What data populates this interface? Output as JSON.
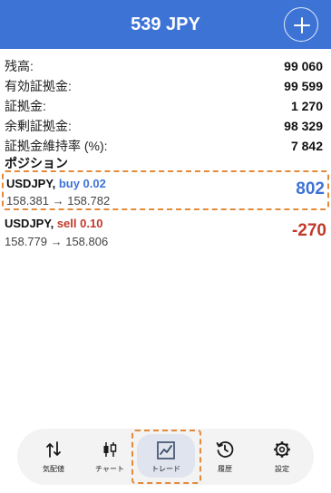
{
  "header": {
    "title": "539 JPY",
    "add_icon": "plus-icon"
  },
  "summary": {
    "rows": [
      {
        "label": "残高:",
        "value": "99 060"
      },
      {
        "label": "有効証拠金:",
        "value": "99 599"
      },
      {
        "label": "証拠金:",
        "value": "1 270"
      },
      {
        "label": "余剰証拠金:",
        "value": "98 329"
      },
      {
        "label": "証拠金維持率 (%):",
        "value": "7 842"
      }
    ]
  },
  "positions": {
    "title": "ポジション",
    "items": [
      {
        "symbol": "USDJPY,",
        "side": "buy 0.02",
        "prices": "158.381 → 158.782",
        "pl": "802"
      },
      {
        "symbol": "USDJPY,",
        "side": "sell 0.10",
        "prices": "158.779 → 158.806",
        "pl": "-270"
      }
    ]
  },
  "nav": {
    "items": [
      {
        "label": "気配値",
        "icon": "quotes-icon"
      },
      {
        "label": "チャート",
        "icon": "chart-icon"
      },
      {
        "label": "トレード",
        "icon": "trade-icon",
        "active": true
      },
      {
        "label": "履歴",
        "icon": "history-icon"
      },
      {
        "label": "設定",
        "icon": "settings-icon"
      }
    ]
  },
  "colors": {
    "accent": "#3e73d6",
    "negative": "#c0392b",
    "highlight": "#e38b3a"
  }
}
